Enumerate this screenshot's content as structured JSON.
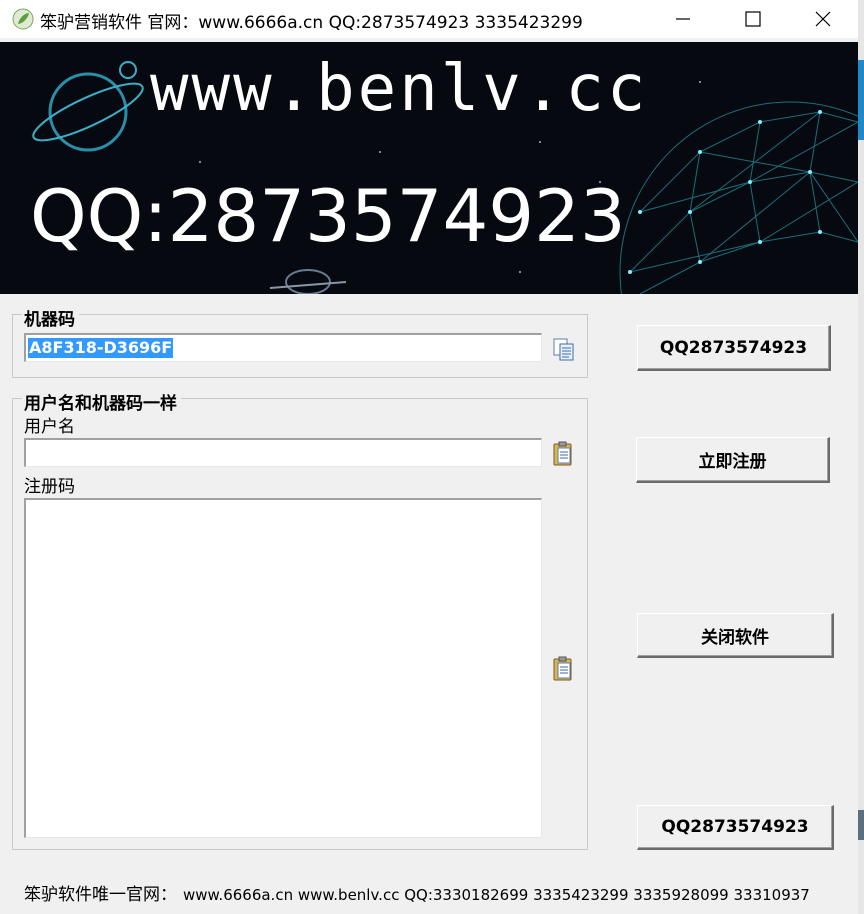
{
  "window": {
    "title": "笨驴营销软件 官网：www.6666a.cn QQ:2873574923  3335423299",
    "controls": [
      "minimize-icon",
      "maximize-icon",
      "close-icon"
    ]
  },
  "banner": {
    "url": "www.benlv.cc",
    "qq": "QQ:2873574923"
  },
  "machine_group": {
    "legend": "机器码",
    "value": "A8F318-D3696F"
  },
  "register_group": {
    "legend": "用户名和机器码一样",
    "username_label": "用户名",
    "username_value": "",
    "code_label": "注册码",
    "code_value": ""
  },
  "buttons": {
    "qq_top": "QQ2873574923",
    "register": "立即注册",
    "close": "关闭软件",
    "qq_bottom": "QQ2873574923"
  },
  "footer": {
    "label": "笨驴软件唯一官网：",
    "links": "www.6666a.cn www.benlv.cc QQ:3330182699  3335423299  3335928099  33310937"
  },
  "colors": {
    "selection": "#3399ff",
    "banner_bg": "#06090f",
    "accent": "#1e88c8"
  }
}
